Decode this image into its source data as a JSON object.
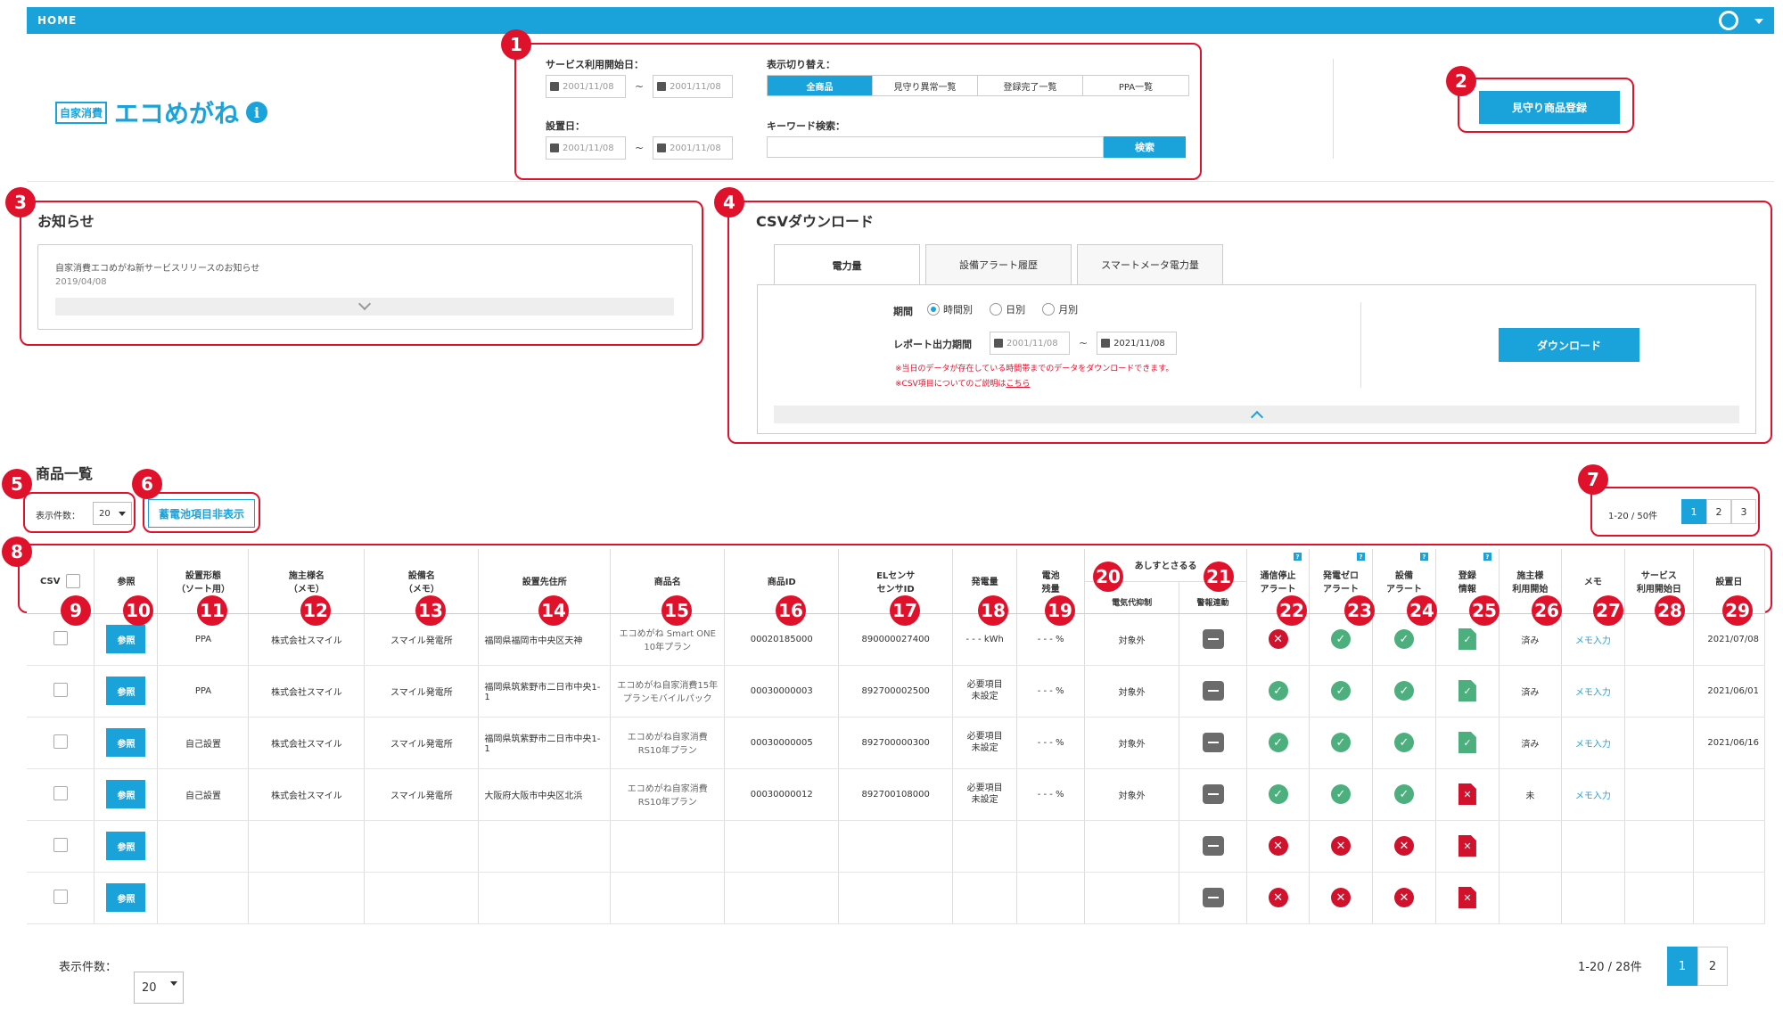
{
  "header": {
    "home": "HOME",
    "user_icon": "user-icon"
  },
  "logo": {
    "tag": "自家消費",
    "name": "エコめがね",
    "info": "i"
  },
  "badges": [
    "1",
    "2",
    "3",
    "4",
    "5",
    "6",
    "7",
    "8",
    "9",
    "10",
    "11",
    "12",
    "13",
    "14",
    "15",
    "16",
    "17",
    "18",
    "19",
    "20",
    "21",
    "22",
    "23",
    "24",
    "25",
    "26",
    "27",
    "28",
    "29"
  ],
  "filter": {
    "service_start_label": "サービス利用開始日：",
    "service_from": "2001/11/08",
    "service_to": "2001/11/08",
    "install_label": "設置日：",
    "install_from": "2001/11/08",
    "install_to": "2001/11/08",
    "tilde": "~",
    "display_label": "表示切り替え：",
    "display_options": [
      "全商品",
      "見守り異常一覧",
      "登録完了一覧",
      "PPA一覧"
    ],
    "keyword_label": "キーワード検索：",
    "keyword_value": "",
    "search_button": "検索"
  },
  "register_button": "見守り商品登録",
  "news": {
    "title": "お知らせ",
    "item_title": "自家消費エコめがね新サービスリリースのお知らせ",
    "item_date": "2019/04/08"
  },
  "csv": {
    "title": "CSVダウンロード",
    "tabs": [
      "電力量",
      "設備アラート履歴",
      "スマートメータ電力量"
    ],
    "period_label": "期間",
    "period_options": [
      "時間別",
      "日別",
      "月別"
    ],
    "report_label": "レポート出力期間",
    "report_from": "2001/11/08",
    "report_to": "2021/11/08",
    "note1": "※当日のデータが存在している時間帯までのデータをダウンロードできます。",
    "note2_prefix": "※CSV項目についてのご説明は",
    "note2_link": "こちら",
    "download_button": "ダウンロード"
  },
  "list": {
    "title": "商品一覧",
    "per_page_label": "表示件数：",
    "per_page_value": "20",
    "battery_toggle": "蓄電池項目非表示",
    "pager_text": "1-20 / 50件",
    "pages": [
      "1",
      "2",
      "3"
    ],
    "columns": {
      "csv": "CSV",
      "ref": "参照",
      "type1": "設置形態",
      "type2": "（ソート用）",
      "owner1": "施主様名",
      "owner2": "（メモ）",
      "facility1": "設備名",
      "facility2": "（メモ）",
      "address": "設置先住所",
      "product": "商品名",
      "product_id": "商品ID",
      "sensor1": "ELセンサ",
      "sensor2": "センサID",
      "generation": "発電量",
      "battery1": "電池",
      "battery2": "残量",
      "ashita": "あしすとさるる",
      "ashita_sub1": "電気代抑制",
      "ashita_sub2": "警報連動",
      "comm1": "通信停止",
      "comm2": "アラート",
      "zero1": "発電ゼロ",
      "zero2": "アラート",
      "equip1": "設備",
      "equip2": "アラート",
      "reg1": "登録",
      "reg2": "情報",
      "owner_use1": "施主様",
      "owner_use2": "利用開始",
      "memo": "メモ",
      "service1": "サービス",
      "service2": "利用開始日",
      "install": "設置日"
    },
    "ref_label": "参照",
    "rows": [
      {
        "type": "PPA",
        "owner": "株式会社スマイル",
        "facility": "スマイル発電所",
        "address": "福岡県福岡市中央区天神",
        "product": "エコめがね Smart ONE 10年プラン",
        "product_id": "00020185000",
        "sensor": "890000027400",
        "generation": "- - - kWh",
        "gen_req": false,
        "battery": "- - - %",
        "denki": "対象外",
        "denki_minus": false,
        "comm": "ng",
        "zero": "ok",
        "equip": "ok",
        "reg": "ok",
        "owner_use": "済み",
        "memo": "メモ入力",
        "install": "2021/07/08"
      },
      {
        "type": "PPA",
        "owner": "株式会社スマイル",
        "facility": "スマイル発電所",
        "address": "福岡県筑紫野市二日市中央1-1",
        "product": "エコめがね自家消費15年プランモバイルパック",
        "product_id": "00030000003",
        "sensor": "892700002500",
        "generation": "必要項目未設定",
        "gen_req": true,
        "battery": "- - - %",
        "denki": "対象外",
        "denki_minus": false,
        "comm": "ok",
        "zero": "ok",
        "equip": "ok",
        "reg": "ok",
        "owner_use": "済み",
        "memo": "メモ入力",
        "install": "2021/06/01"
      },
      {
        "type": "自己設置",
        "owner": "株式会社スマイル",
        "facility": "スマイル発電所",
        "address": "福岡県筑紫野市二日市中央1-1",
        "product": "エコめがね自家消費RS10年プラン",
        "product_id": "00030000005",
        "sensor": "892700000300",
        "generation": "必要項目未設定",
        "gen_req": true,
        "battery": "- - - %",
        "denki": "対象外",
        "denki_minus": false,
        "comm": "ok",
        "zero": "ok",
        "equip": "ok",
        "reg": "ok",
        "owner_use": "済み",
        "memo": "メモ入力",
        "install": "2021/06/16"
      },
      {
        "type": "自己設置",
        "owner": "株式会社スマイル",
        "facility": "スマイル発電所",
        "address": "大阪府大阪市中央区北浜",
        "product": "エコめがね自家消費RS10年プラン",
        "product_id": "00030000012",
        "sensor": "892700108000",
        "generation": "必要項目未設定",
        "gen_req": true,
        "battery": "- - - %",
        "denki": "対象外",
        "denki_minus": false,
        "comm": "ok",
        "zero": "ok",
        "equip": "ok",
        "reg": "ng",
        "owner_use": "未",
        "memo": "メモ入力",
        "install": ""
      },
      "…",
      "…"
    ],
    "footer_per_page_label": "表示件数：",
    "footer_per_page_value": "20",
    "footer_pager_text": "1-20 / 28件",
    "footer_pages": [
      "1",
      "2"
    ]
  }
}
